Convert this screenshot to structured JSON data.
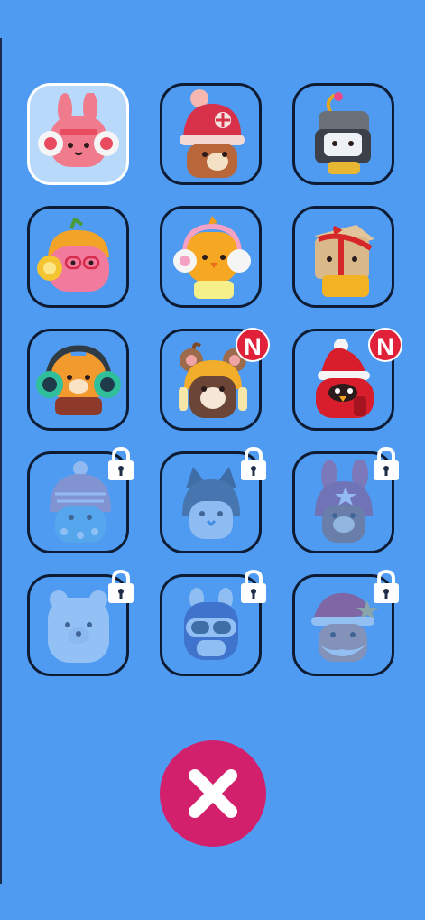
{
  "screen": {
    "title": ""
  },
  "colors": {
    "background": "#4f9bf2",
    "close_button": "#d3206d",
    "new_badge": "#e1203a",
    "tile_border": "#0e1c33"
  },
  "characters": [
    {
      "id": "pink-bunny-headphones",
      "state": "selected",
      "badge": ""
    },
    {
      "id": "bear-red-beanie",
      "state": "unlocked",
      "badge": ""
    },
    {
      "id": "robot-antenna",
      "state": "unlocked",
      "badge": ""
    },
    {
      "id": "pink-blob-yellow-headphones",
      "state": "unlocked",
      "badge": ""
    },
    {
      "id": "yellow-chick-pink-headphones",
      "state": "unlocked",
      "badge": ""
    },
    {
      "id": "gift-box-ribbon",
      "state": "unlocked",
      "badge": ""
    },
    {
      "id": "bear-teal-headphones",
      "state": "unlocked",
      "badge": ""
    },
    {
      "id": "mouse-yellow-hood",
      "state": "new",
      "badge": "N"
    },
    {
      "id": "bird-santa-hat",
      "state": "new",
      "badge": "N"
    },
    {
      "id": "penguin-knit-hat",
      "state": "locked",
      "badge": ""
    },
    {
      "id": "cat-dark-hood",
      "state": "locked",
      "badge": ""
    },
    {
      "id": "bunny-star-hood",
      "state": "locked",
      "badge": ""
    },
    {
      "id": "polar-bear",
      "state": "locked",
      "badge": ""
    },
    {
      "id": "goggles-critter",
      "state": "locked",
      "badge": ""
    },
    {
      "id": "santa-beard",
      "state": "locked",
      "badge": ""
    }
  ],
  "close": {
    "icon": "close-icon"
  }
}
